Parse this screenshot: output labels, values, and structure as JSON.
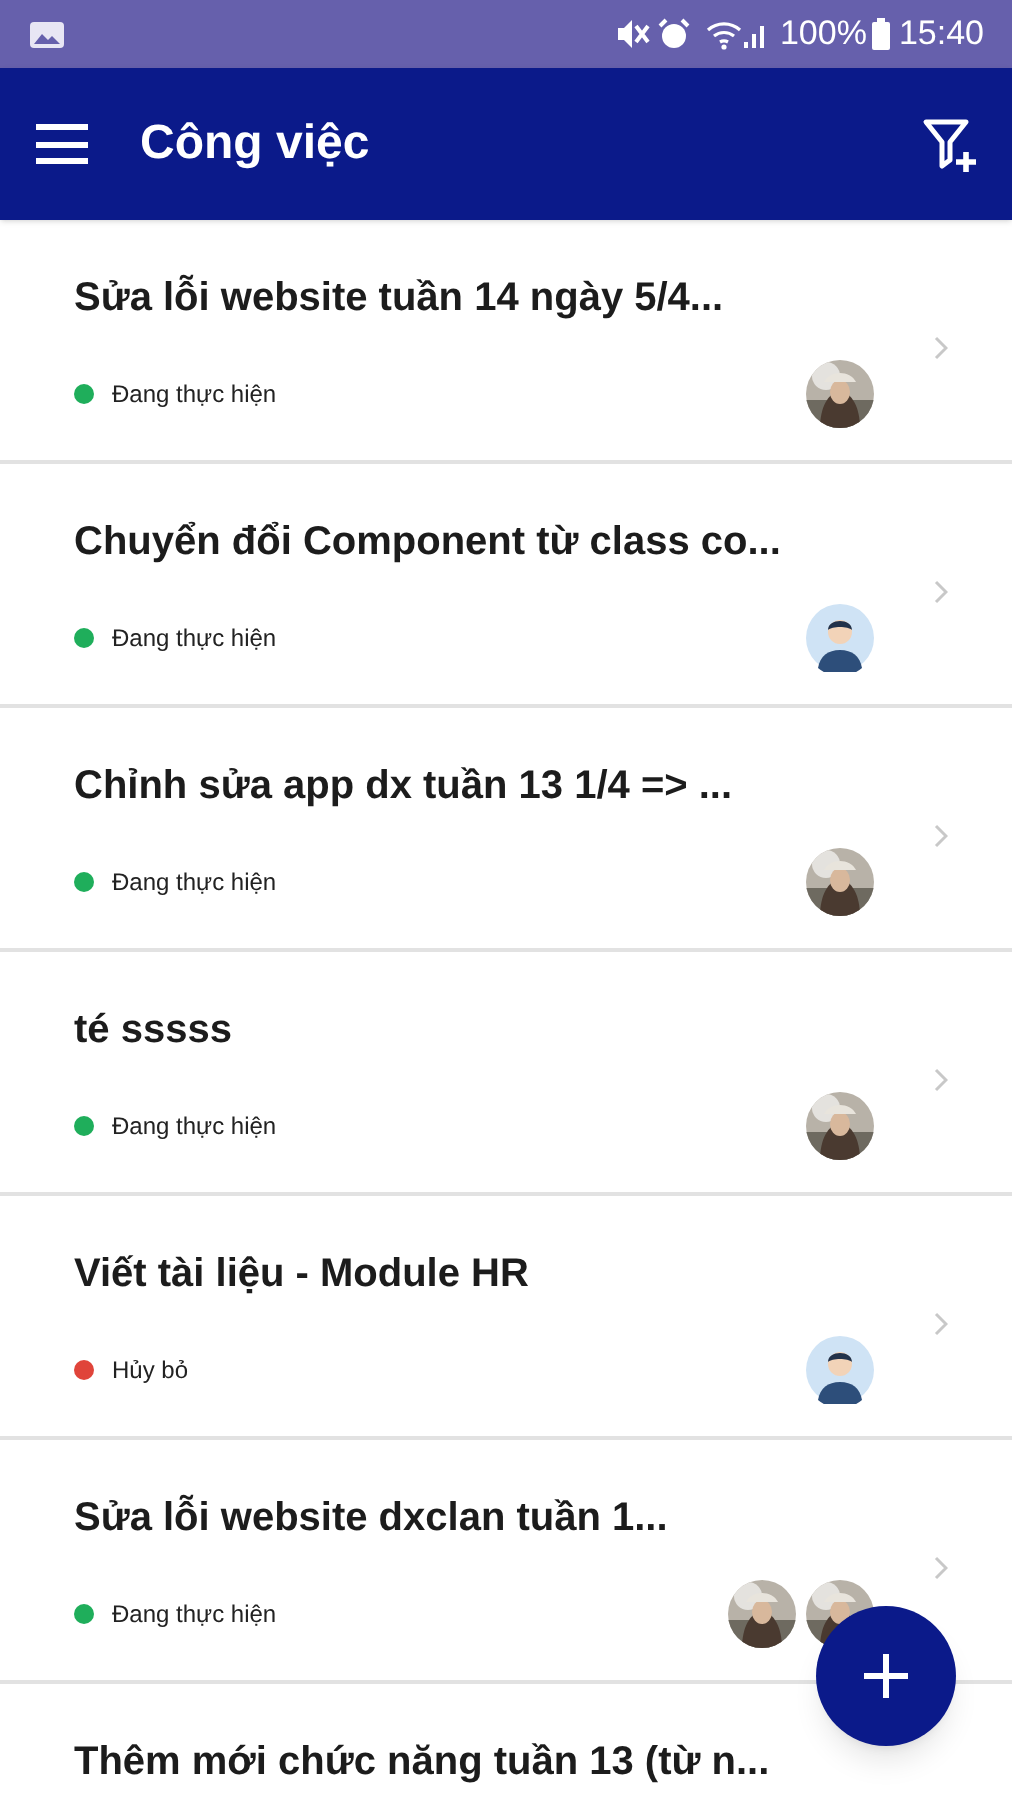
{
  "status_bar": {
    "battery": "100%",
    "time": "15:40"
  },
  "header": {
    "title": "Công việc"
  },
  "tasks": [
    {
      "title": "Sửa lỗi website tuần 14 ngày 5/4...",
      "status": "Đang thực hiện",
      "color": "#1fae5b"
    },
    {
      "title": "Chuyển đổi Component từ class co...",
      "status": "Đang thực hiện",
      "color": "#1fae5b",
      "avatars": [
        {
          "kind": "silhouette"
        }
      ]
    },
    {
      "title": "Chỉnh sửa app dx tuần 13 1/4 => ...",
      "status": "Đang thực hiện",
      "color": "#1fae5b"
    },
    {
      "title": "té sssss",
      "status": "Đang thực hiện",
      "color": "#1fae5b"
    },
    {
      "title": "Viết tài liệu - Module HR",
      "status": "Hủy bỏ",
      "color": "#e0443a",
      "avatars": [
        {
          "kind": "silhouette"
        }
      ]
    },
    {
      "title": "Sửa lỗi website dxclan tuần 1...",
      "status": "Đang thực hiện",
      "color": "#1fae5b"
    },
    {
      "title": "Thêm mới chức năng tuần 13 (từ n..."
    }
  ]
}
